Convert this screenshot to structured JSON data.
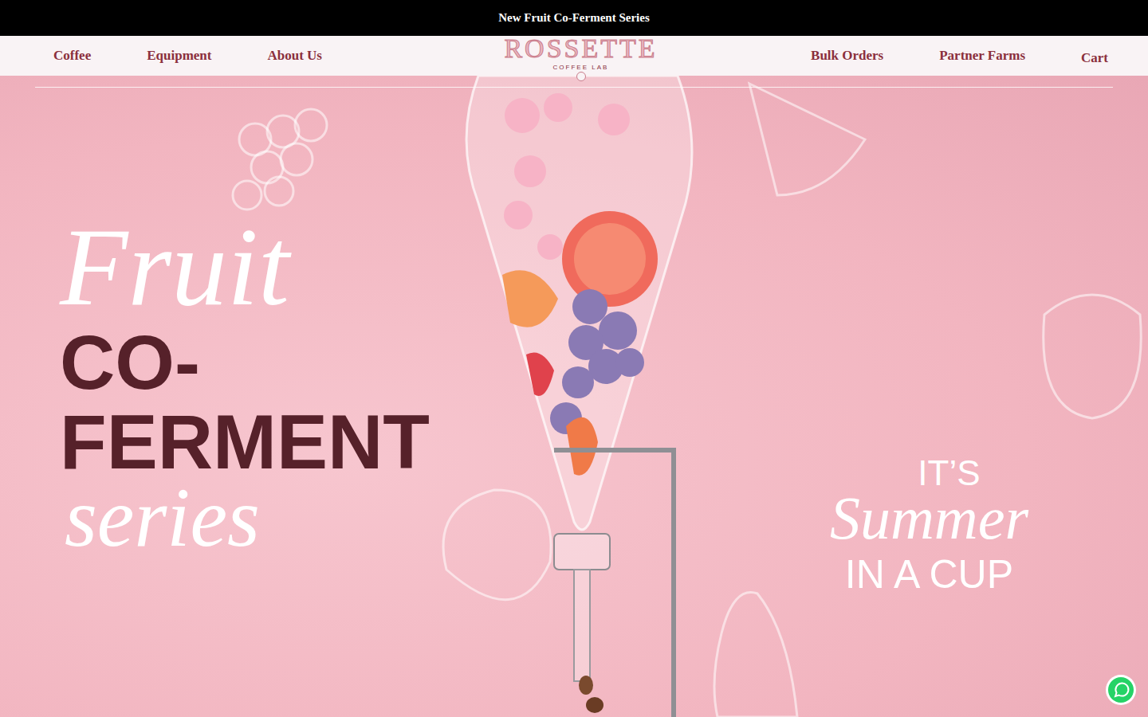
{
  "announcement": "New Fruit Co-Ferment Series",
  "nav": {
    "left": [
      "Coffee",
      "Equipment",
      "About Us"
    ],
    "logo": {
      "name": "ROSSETTE",
      "tagline": "COFFEE LAB"
    },
    "right": [
      "Bulk Orders",
      "Partner Farms"
    ],
    "cart": "Cart"
  },
  "hero": {
    "title": {
      "script_top": "Fruit",
      "line1": "CO-",
      "line2": "FERMENT",
      "script_bottom": "series"
    },
    "tagline": {
      "top": "IT’S",
      "script": "Summer",
      "bottom": "IN A CUP"
    }
  }
}
